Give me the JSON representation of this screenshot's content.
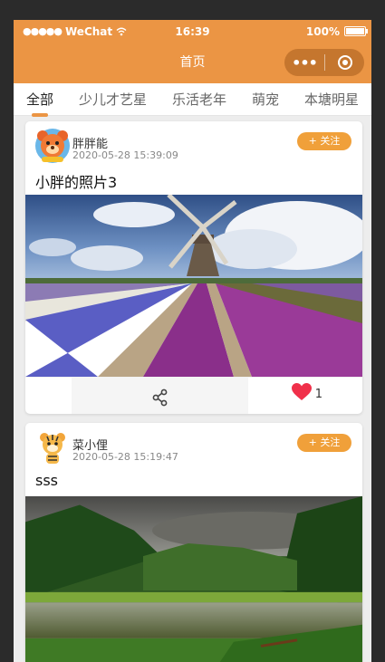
{
  "status": {
    "carrier": "WeChat",
    "time": "16:39",
    "battery": "100%"
  },
  "nav": {
    "title": "首页"
  },
  "tabs": [
    {
      "label": "全部",
      "active": true
    },
    {
      "label": "少儿才艺星",
      "active": false
    },
    {
      "label": "乐活老年",
      "active": false
    },
    {
      "label": "萌宠",
      "active": false
    },
    {
      "label": "本塘明星",
      "active": false
    }
  ],
  "posts": [
    {
      "user": "胖胖能",
      "time": "2020-05-28 15:39:09",
      "follow_label": "+ 关注",
      "title": "小胖的照片3",
      "image": "windmill-tulip-field-photo",
      "likes": "1",
      "avatar": "cartoon-bear-avatar"
    },
    {
      "user": "菜小俚",
      "time": "2020-05-28 15:19:47",
      "follow_label": "+ 关注",
      "title": "sss",
      "image": "forest-lake-landscape-photo",
      "avatar": "cartoon-tiger-avatar"
    }
  ],
  "colors": {
    "brand": "#eb9544",
    "follow": "#f0a03a",
    "like": "#f0304a"
  }
}
